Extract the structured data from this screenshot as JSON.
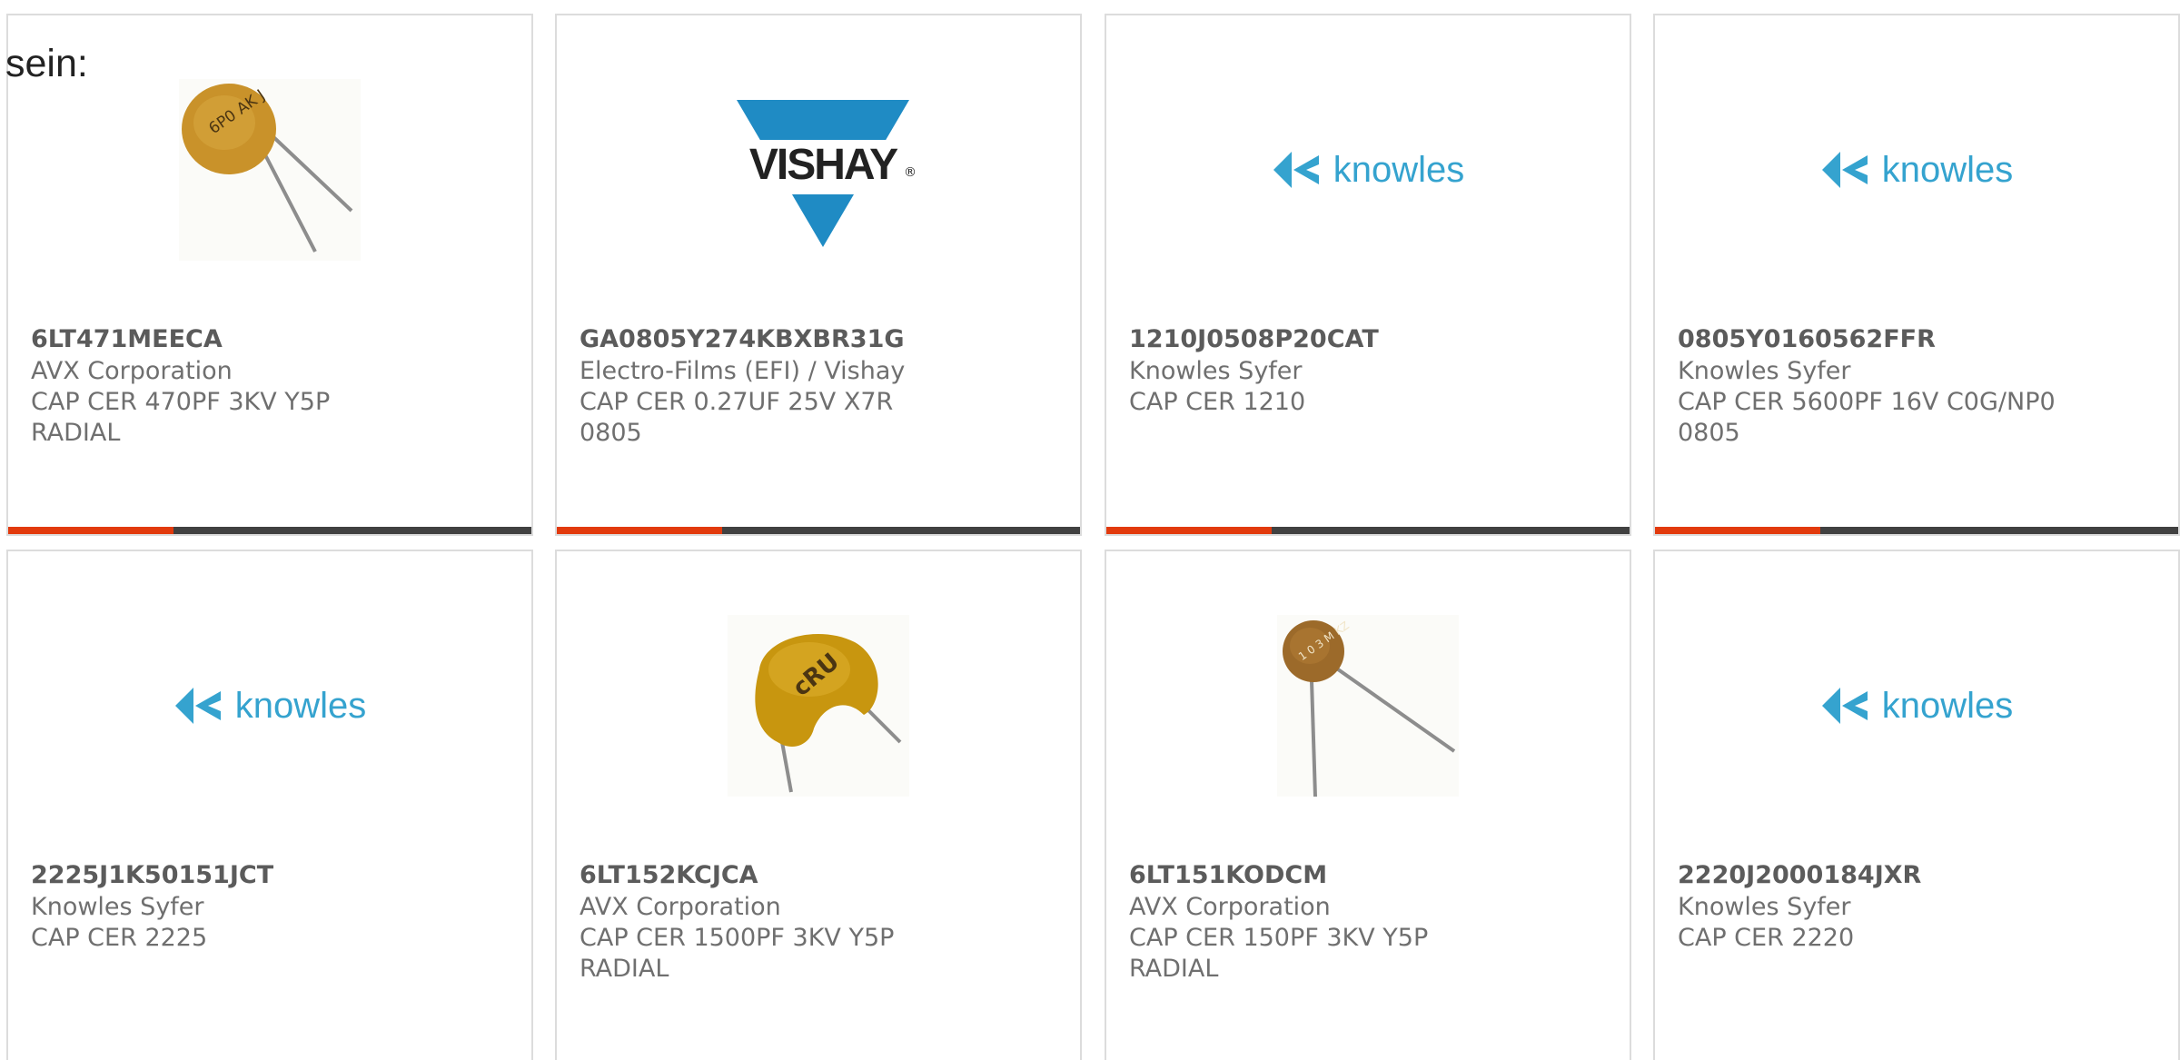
{
  "intro_text": "sein:",
  "products": [
    {
      "part_number": "6LT471MEECA",
      "manufacturer": "AVX Corporation",
      "description": "CAP CER 470PF 3KV Y5P RADIAL",
      "image": "radial-capacitor-small",
      "cap_label": "6P0 AK J"
    },
    {
      "part_number": "GA0805Y274KBXBR31G",
      "manufacturer": "Electro-Films (EFI) / Vishay",
      "description": "CAP CER 0.27UF 25V X7R 0805",
      "image": "vishay-logo",
      "logo_text": "VISHAY",
      "logo_mark": "®"
    },
    {
      "part_number": "1210J0508P20CAT",
      "manufacturer": "Knowles Syfer",
      "description": "CAP CER 1210",
      "image": "knowles-logo",
      "logo_text": "knowles"
    },
    {
      "part_number": "0805Y0160562FFR",
      "manufacturer": "Knowles Syfer",
      "description": "CAP CER 5600PF 16V C0G/NP0 0805",
      "image": "knowles-logo",
      "logo_text": "knowles"
    },
    {
      "part_number": "2225J1K50151JCT",
      "manufacturer": "Knowles Syfer",
      "description": "CAP CER 2225",
      "image": "knowles-logo",
      "logo_text": "knowles"
    },
    {
      "part_number": "6LT152KCJCA",
      "manufacturer": "AVX Corporation",
      "description": "CAP CER 1500PF 3KV Y5P RADIAL",
      "image": "radial-capacitor-large",
      "cap_label": "cRU"
    },
    {
      "part_number": "6LT151KODCM",
      "manufacturer": "AVX Corporation",
      "description": "CAP CER 150PF 3KV Y5P RADIAL",
      "image": "radial-capacitor-small",
      "cap_label": "1 0 3 M KZ"
    },
    {
      "part_number": "2220J2000184JXR",
      "manufacturer": "Knowles Syfer",
      "description": "CAP CER 2220",
      "image": "knowles-logo",
      "logo_text": "knowles"
    }
  ],
  "colors": {
    "knowles_blue": "#35a3cf",
    "vishay_blue": "#1f8bc4",
    "accent_orange": "#e23a0d",
    "bar_dark": "#414141",
    "capacitor_body": "#c9922a"
  }
}
